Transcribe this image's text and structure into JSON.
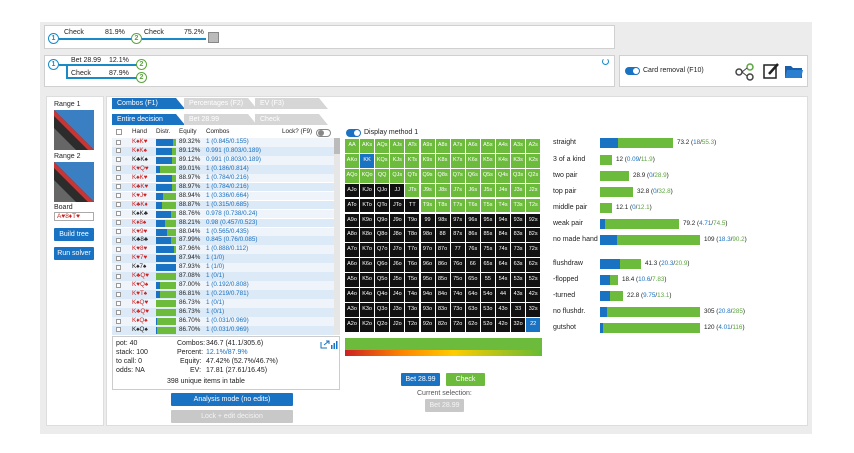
{
  "tree1": {
    "n1": "1",
    "n2": "2",
    "a1": "Check",
    "p1": "81.9%",
    "a2": "Check",
    "p2": "75.2%"
  },
  "tree2": {
    "n1": "1",
    "n2a": "2",
    "n2b": "2",
    "a1": "Bet 28.99",
    "p1": "12.1%",
    "a2": "Check",
    "p2": "87.9%"
  },
  "tools": {
    "card_removal": "Card removal (F10)"
  },
  "left": {
    "range1": "Range 1",
    "range2": "Range 2",
    "board_label": "Board",
    "board": "A♥8♦T♥",
    "build": "Build tree",
    "run": "Run solver"
  },
  "tabs": {
    "combos": "Combos (F1)",
    "percentages": "Percentages (F2)",
    "ev": "EV (F3)",
    "entire": "Entire decision",
    "bet": "Bet 28.99",
    "check": "Check"
  },
  "table": {
    "headers": {
      "hand": "Hand",
      "distr": "Distr.",
      "equity": "Equity",
      "combos": "Combos",
      "lock": "Lock? (F9)"
    },
    "rows": [
      {
        "hand": "K♠K♥",
        "eq": "89.32%",
        "c": "1 (0.845/0.155)",
        "d": 0.85
      },
      {
        "hand": "K♦K♠",
        "eq": "89.12%",
        "c": "0.991 (0.803/0.189)",
        "d": 0.8
      },
      {
        "hand": "K♣K♠",
        "eq": "89.12%",
        "c": "0.991 (0.803/0.189)",
        "d": 0.8
      },
      {
        "hand": "K♥Q♥",
        "eq": "89.01%",
        "c": "1 (0.186/0.814)",
        "d": 0.18
      },
      {
        "hand": "K♠K♥",
        "eq": "88.97%",
        "c": "1 (0.784/0.216)",
        "d": 0.78
      },
      {
        "hand": "K♣K♥",
        "eq": "88.97%",
        "c": "1 (0.784/0.216)",
        "d": 0.78
      },
      {
        "hand": "K♥J♥",
        "eq": "88.94%",
        "c": "1 (0.336/0.664)",
        "d": 0.33
      },
      {
        "hand": "K♣K♦",
        "eq": "88.87%",
        "c": "1 (0.315/0.685)",
        "d": 0.31
      },
      {
        "hand": "K♠K♣",
        "eq": "88.76%",
        "c": "0.978 (0.738/0.24)",
        "d": 0.74
      },
      {
        "hand": "K♦8♠",
        "eq": "88.21%",
        "c": "0.98 (0.457/0.523)",
        "d": 0.46
      },
      {
        "hand": "K♥9♥",
        "eq": "88.04%",
        "c": "1 (0.565/0.435)",
        "d": 0.56
      },
      {
        "hand": "K♣8♣",
        "eq": "87.99%",
        "c": "0.845 (0.76/0.085)",
        "d": 0.76
      },
      {
        "hand": "K♥8♥",
        "eq": "87.96%",
        "c": "1 (0.888/0.112)",
        "d": 0.89
      },
      {
        "hand": "K♥7♥",
        "eq": "87.94%",
        "c": "1 (1/0)",
        "d": 1
      },
      {
        "hand": "K♠7♠",
        "eq": "87.93%",
        "c": "1 (1/0)",
        "d": 1
      },
      {
        "hand": "K♣Q♥",
        "eq": "87.08%",
        "c": "1 (0/1)",
        "d": 0
      },
      {
        "hand": "K♥Q♠",
        "eq": "87.00%",
        "c": "1 (0.192/0.808)",
        "d": 0.19
      },
      {
        "hand": "K♥T♠",
        "eq": "86.81%",
        "c": "1 (0.219/0.781)",
        "d": 0.22
      },
      {
        "hand": "K♠Q♥",
        "eq": "86.73%",
        "c": "1 (0/1)",
        "d": 0
      },
      {
        "hand": "K♣Q♥",
        "eq": "86.73%",
        "c": "1 (0/1)",
        "d": 0
      },
      {
        "hand": "K♦Q♠",
        "eq": "86.70%",
        "c": "1 (0.031/0.969)",
        "d": 0.03
      },
      {
        "hand": "K♠Q♠",
        "eq": "86.70%",
        "c": "1 (0.031/0.969)",
        "d": 0.03
      }
    ],
    "summary": {
      "pot": "pot: 40",
      "stack": "stack: 100",
      "tocall": "to call: 0",
      "odds": "odds: NA",
      "combos_l": "Combos:",
      "combos_v": "346.7 (41.1/305.6)",
      "percent_l": "Percent:",
      "percent_v": "12.1%/87.9%",
      "equity_l": "Equity:",
      "equity_v": "47.42% (52.7%/46.7%)",
      "ev_l": "EV:",
      "ev_v": "17.81 (27.61/16.45)",
      "unique": "398 unique items in table"
    }
  },
  "analysis": "Analysis mode (no edits)",
  "lock_edit": "Lock + edit decision",
  "matrix": {
    "display": "Display method 1",
    "ranks": [
      "A",
      "K",
      "Q",
      "J",
      "T",
      "9",
      "8",
      "7",
      "6",
      "5",
      "4",
      "3",
      "2"
    ]
  },
  "actions": {
    "bet": "Bet 28.99",
    "check": "Check",
    "current": "Current selection:",
    "current_val": "Bet 28.99"
  },
  "stats": [
    {
      "name": "straight",
      "v": "73.2",
      "a": "18",
      "b": "55.3",
      "w": 0.73
    },
    {
      "name": "3 of a kind",
      "v": "12",
      "a": "0.09",
      "b": "11.9",
      "w": 0.12
    },
    {
      "name": "two pair",
      "v": "28.9",
      "a": "0",
      "b": "28.9",
      "w": 0.29
    },
    {
      "name": "top pair",
      "v": "32.8",
      "a": "0",
      "b": "32.8",
      "w": 0.33
    },
    {
      "name": "middle pair",
      "v": "12.1",
      "a": "0",
      "b": "12.1",
      "w": 0.12
    },
    {
      "name": "weak pair",
      "v": "79.2",
      "a": "4.71",
      "b": "74.5",
      "w": 0.79
    },
    {
      "name": "no made hand",
      "v": "109",
      "a": "18.3",
      "b": "90.2",
      "w": 1.0
    },
    {
      "name": "flushdraw",
      "v": "41.3",
      "a": "20.3",
      "b": "20.9",
      "w": 0.41
    },
    {
      "name": "-flopped",
      "v": "18.4",
      "a": "10.6",
      "b": "7.83",
      "w": 0.18
    },
    {
      "name": "-turned",
      "v": "22.8",
      "a": "9.75",
      "b": "13.1",
      "w": 0.23
    },
    {
      "name": "no flushdr.",
      "v": "305",
      "a": "20.8",
      "b": "285",
      "w": 1.0
    },
    {
      "name": "gutshot",
      "v": "120",
      "a": "4.01",
      "b": "116",
      "w": 1.0
    }
  ]
}
